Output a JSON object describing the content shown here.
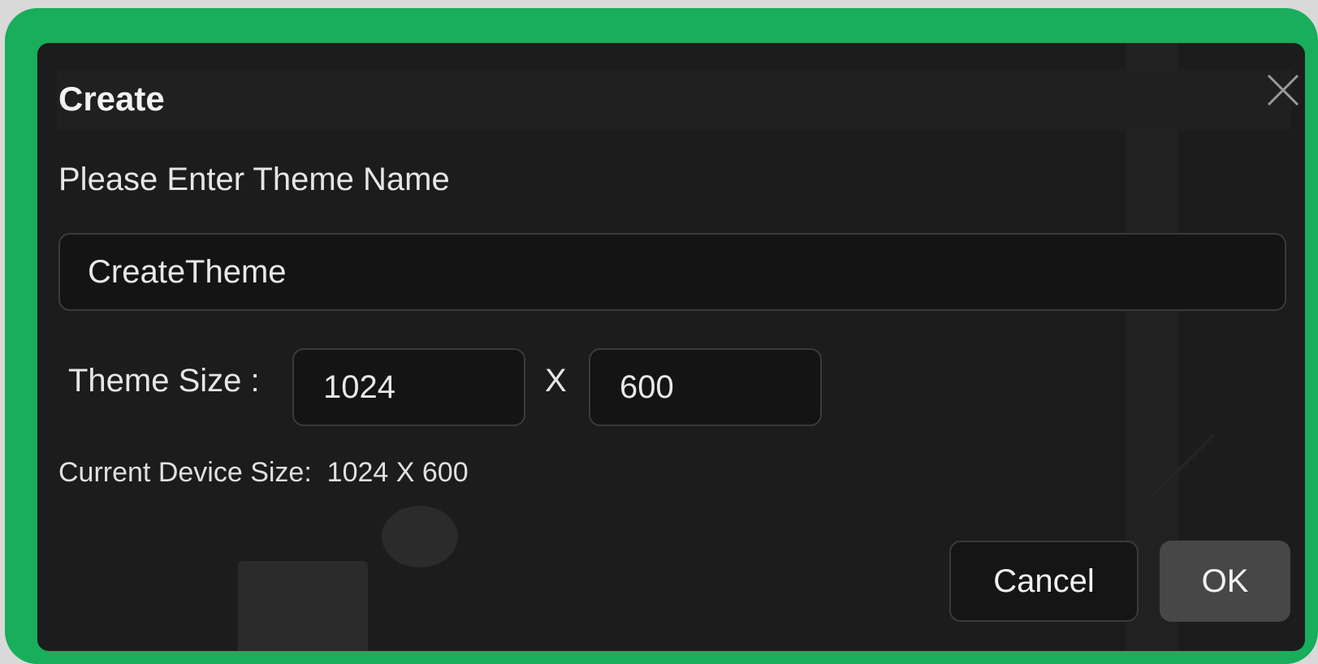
{
  "dialog": {
    "title": "Create",
    "close_icon": "close-icon",
    "prompt": "Please Enter Theme Name",
    "theme_name_value": "CreateTheme",
    "size_label": "Theme Size :",
    "width_value": "1024",
    "separator": "X",
    "height_value": "600",
    "device_size_text": "Current Device Size:  1024 X 600",
    "cancel_label": "Cancel",
    "ok_label": "OK"
  },
  "colors": {
    "frame": "#18ae5b",
    "dialog_bg": "#1c1c1c",
    "input_bg": "#141414",
    "ok_bg": "#474747"
  }
}
